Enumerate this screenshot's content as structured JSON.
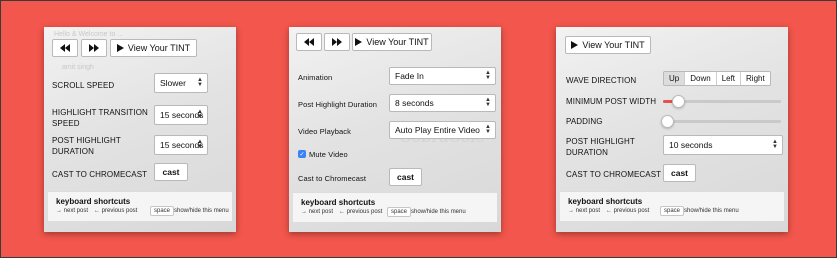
{
  "colors": {
    "background": "#f2564c",
    "slider_accent": "#e8504b",
    "checkbox": "#3b82f6"
  },
  "common": {
    "view_tint": "View Your TINT",
    "cast": "cast",
    "shortcuts_title": "keyboard shortcuts",
    "next_post": "→ next post",
    "prev_post": "← previous post",
    "space_key": "space",
    "show_hide": "show/hide this menu",
    "rewind_icon": "rewind-icon",
    "fast_forward_icon": "fast-forward-icon",
    "play_icon": "play-icon"
  },
  "panel1": {
    "faint_text_1": "Hello & Welcome to ...",
    "faint_text_2": "amit singh",
    "scroll_speed_label": "SCROLL SPEED",
    "scroll_speed_value": "Slower",
    "highlight_transition_label": "HIGHLIGHT TRANSITION SPEED",
    "highlight_transition_value": "15 seconds",
    "post_highlight_label": "POST HIGHLIGHT DURATION",
    "post_highlight_value": "15 seconds",
    "cast_label": "CAST TO CHROMECAST"
  },
  "panel2": {
    "animation_label": "Animation",
    "animation_value": "Fade In",
    "post_highlight_label": "Post Highlight Duration",
    "post_highlight_value": "8 seconds",
    "video_playback_label": "Video Playback",
    "video_playback_value": "Auto Play Entire Video",
    "mute_video_label": "Mute Video",
    "mute_video_checked": true,
    "cast_label": "Cast to Chromecast",
    "watermark": "CobraCole"
  },
  "panel3": {
    "wave_direction_label": "WAVE DIRECTION",
    "wave_options": [
      "Up",
      "Down",
      "Left",
      "Right"
    ],
    "wave_selected": "Up",
    "min_post_width_label": "MINIMUM POST WIDTH",
    "min_post_width_level": 0.12,
    "padding_label": "PADDING",
    "padding_level": 0.0,
    "post_highlight_label": "POST HIGHLIGHT DURATION",
    "post_highlight_value": "10 seconds",
    "cast_label": "CAST TO CHROMECAST"
  }
}
